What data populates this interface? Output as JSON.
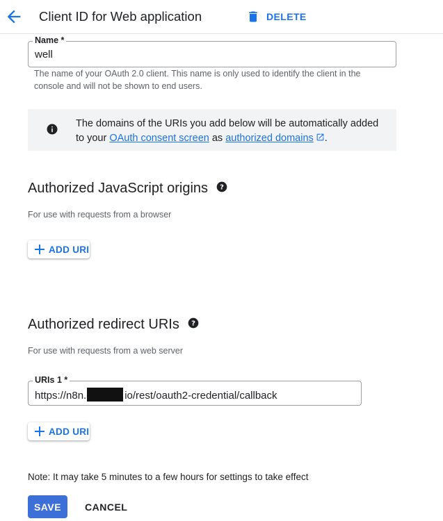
{
  "header": {
    "title": "Client ID for Web application",
    "back_icon": "arrow-back-icon",
    "delete_icon": "trash-icon",
    "delete_label": "DELETE"
  },
  "name_field": {
    "label": "Name *",
    "value": "well",
    "helper": "The name of your OAuth 2.0 client. This name is only used to identify the client in the console and will not be shown to end users."
  },
  "info": {
    "icon": "info-icon",
    "text_before": "The domains of the URIs you add below will be automatically added to your ",
    "consent_link": "OAuth consent screen",
    "text_middle": " as ",
    "domains_link": "authorized domains",
    "external_icon": "external-link-icon",
    "text_after": "."
  },
  "js_origins": {
    "title": "Authorized JavaScript origins",
    "help_icon": "help-icon",
    "subtitle": "For use with requests from a browser",
    "add_label": "ADD URI"
  },
  "redirect_uris": {
    "title": "Authorized redirect URIs",
    "help_icon": "help-icon",
    "subtitle": "For use with requests from a web server",
    "uri_label": "URIs 1 *",
    "uri_prefix": "https://n8n.",
    "uri_suffix": "io/rest/oauth2-credential/callback",
    "add_label": "ADD URI"
  },
  "footer": {
    "note": "Note: It may take 5 minutes to a few hours for settings to take effect",
    "save_label": "SAVE",
    "cancel_label": "CANCEL"
  },
  "colors": {
    "accent": "#1a73e8",
    "save_button": "#3c6fd8",
    "info_background": "#f1f3f4"
  }
}
